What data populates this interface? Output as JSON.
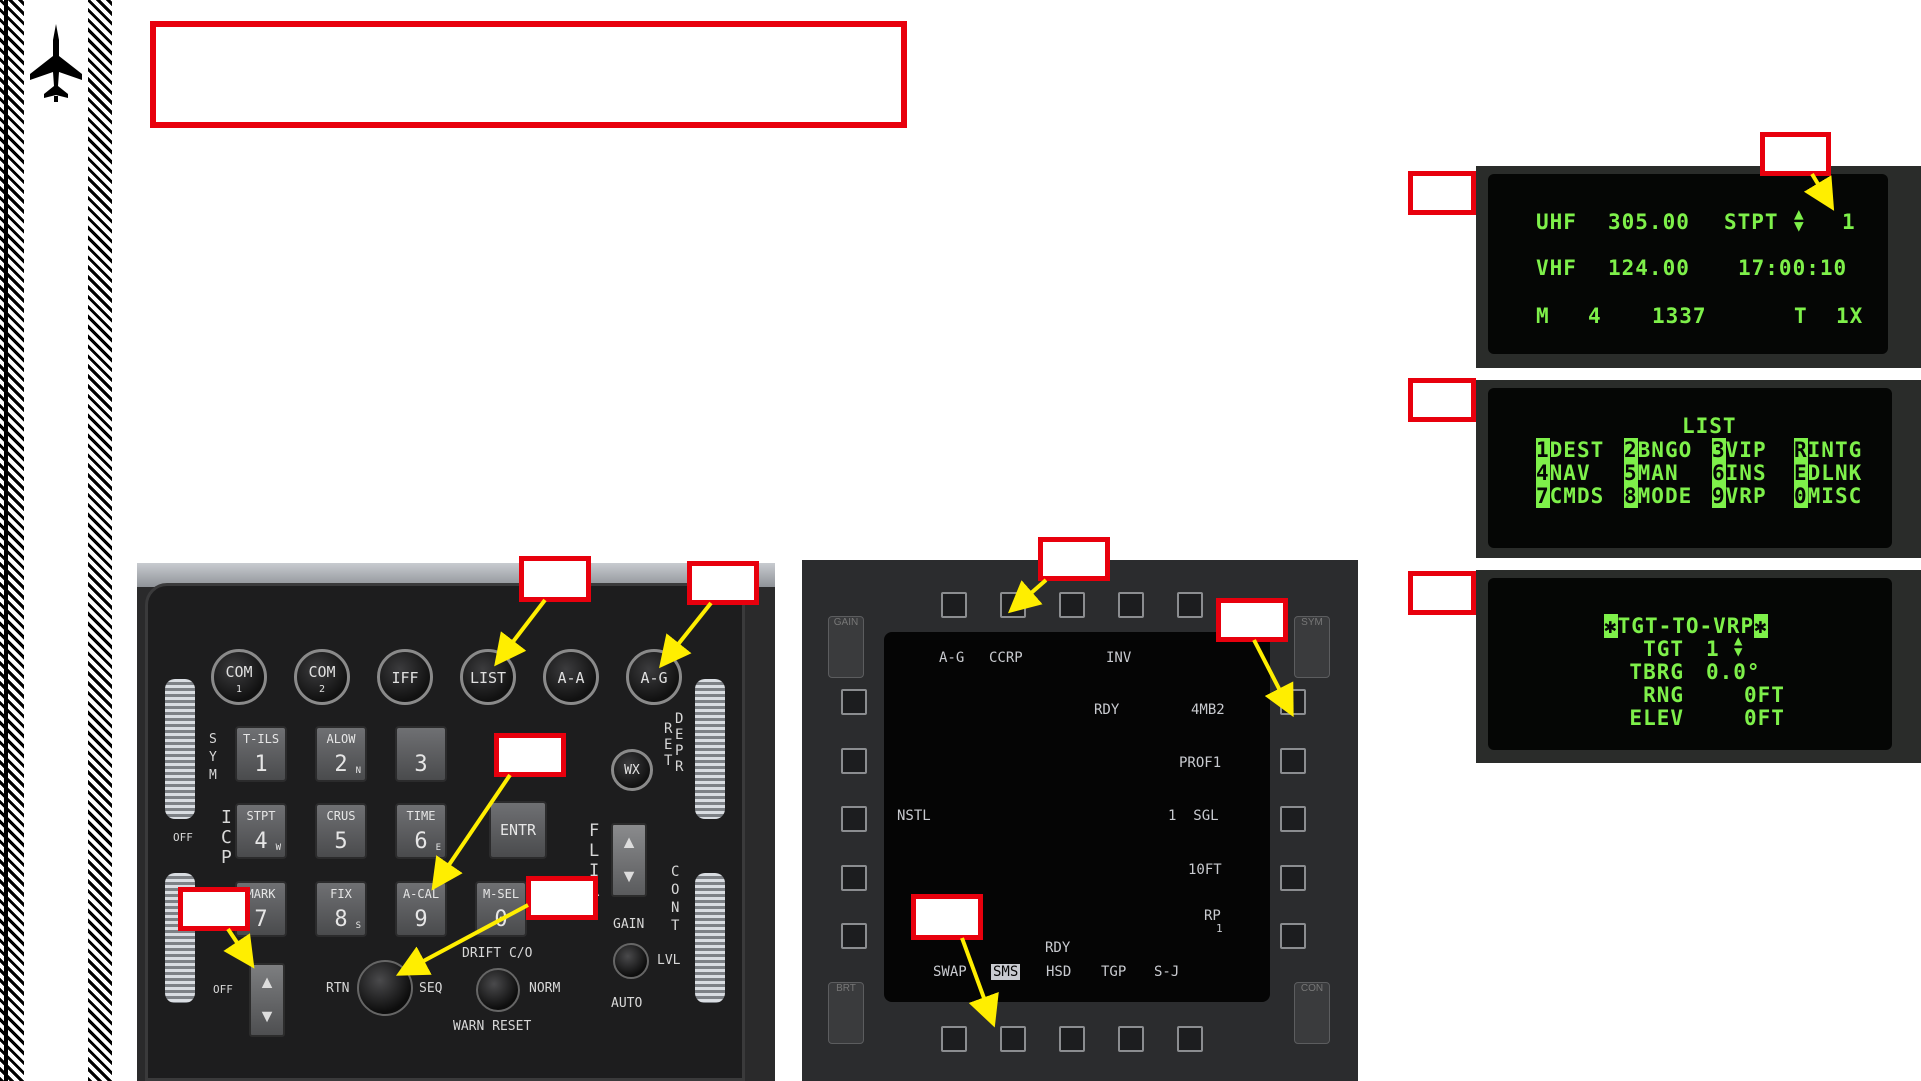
{
  "colors": {
    "accent_red": "#e8000d",
    "arrow_yellow": "#ffee00",
    "ded_green": "#7ef04a",
    "hatch": "#000000"
  },
  "sidebar": {
    "icon": "jet-silhouette-icon"
  },
  "icp": {
    "top_buttons": [
      {
        "label": "COM",
        "sub": "1"
      },
      {
        "label": "COM",
        "sub": "2"
      },
      {
        "label": "IFF",
        "sub": ""
      },
      {
        "label": "LIST",
        "sub": ""
      },
      {
        "label": "A-A",
        "sub": ""
      },
      {
        "label": "A-G",
        "sub": ""
      }
    ],
    "keys": [
      {
        "top": "T-ILS",
        "num": "1",
        "sub": ""
      },
      {
        "top": "ALOW",
        "num": "2",
        "sub": "N"
      },
      {
        "top": "",
        "num": "3",
        "sub": ""
      },
      {
        "top": "STPT",
        "num": "4",
        "sub": "W"
      },
      {
        "top": "CRUS",
        "num": "5",
        "sub": ""
      },
      {
        "top": "TIME",
        "num": "6",
        "sub": "E"
      },
      {
        "top": "MARK",
        "num": "7",
        "sub": ""
      },
      {
        "top": "FIX",
        "num": "8",
        "sub": "S"
      },
      {
        "top": "A-CAL",
        "num": "9",
        "sub": ""
      },
      {
        "top": "M-SEL",
        "num": "0",
        "sub": ""
      }
    ],
    "entr": "ENTR",
    "wx": "WX",
    "labels": {
      "sym": "S Y M",
      "icp": "I C P",
      "off1": "OFF",
      "off2": "OFF",
      "ret_depr": "R E T",
      "depr": "D E P R",
      "flir": "F L I R",
      "cont": "C O N T",
      "gain": "GAIN",
      "lvl": "LVL",
      "auto": "AUTO",
      "drift": "DRIFT C/O",
      "norm": "NORM",
      "warn_reset": "WARN RESET",
      "rtn": "RTN",
      "seq": "SEQ"
    }
  },
  "mfd": {
    "top_labels": [
      "A-G",
      "CCRP",
      "INV"
    ],
    "rdy": "RDY",
    "rdy_bottom": "RDY",
    "right_labels": [
      "4MB2",
      "PROF1",
      "1  SGL",
      "10FT",
      "RP"
    ],
    "rp_sub": "1",
    "left_label": "NSTL",
    "bottom_labels": [
      "SWAP",
      "SMS",
      "HSD",
      "TGP",
      "S-J"
    ],
    "side_marks": {
      "gain": "GAIN",
      "sym": "SYM",
      "brt": "BRT",
      "con": "CON"
    }
  },
  "ded1": {
    "line1": {
      "a": "UHF",
      "b": "305.00",
      "c": "STPT",
      "d": "1"
    },
    "line2": {
      "a": "VHF",
      "b": "124.00",
      "c": "17:00:10"
    },
    "line3": {
      "a": "M",
      "b": "4",
      "c": "1337",
      "d": "T",
      "e": "1X"
    }
  },
  "ded2": {
    "title": "LIST",
    "items": [
      {
        "k": "1",
        "v": "DEST"
      },
      {
        "k": "2",
        "v": "BNGO"
      },
      {
        "k": "3",
        "v": "VIP"
      },
      {
        "k": "R",
        "v": "INTG"
      },
      {
        "k": "4",
        "v": "NAV"
      },
      {
        "k": "5",
        "v": "MAN"
      },
      {
        "k": "6",
        "v": "INS"
      },
      {
        "k": "E",
        "v": "DLNK"
      },
      {
        "k": "7",
        "v": "CMDS"
      },
      {
        "k": "8",
        "v": "MODE"
      },
      {
        "k": "9",
        "v": "VRP"
      },
      {
        "k": "0",
        "v": "MISC"
      }
    ]
  },
  "ded3": {
    "title": "TGT-TO-VRP",
    "rows": [
      {
        "k": "TGT",
        "v": "1"
      },
      {
        "k": "TBRG",
        "v": "0.0°"
      },
      {
        "k": "RNG",
        "v": "0FT"
      },
      {
        "k": "ELEV",
        "v": "0FT"
      }
    ]
  }
}
